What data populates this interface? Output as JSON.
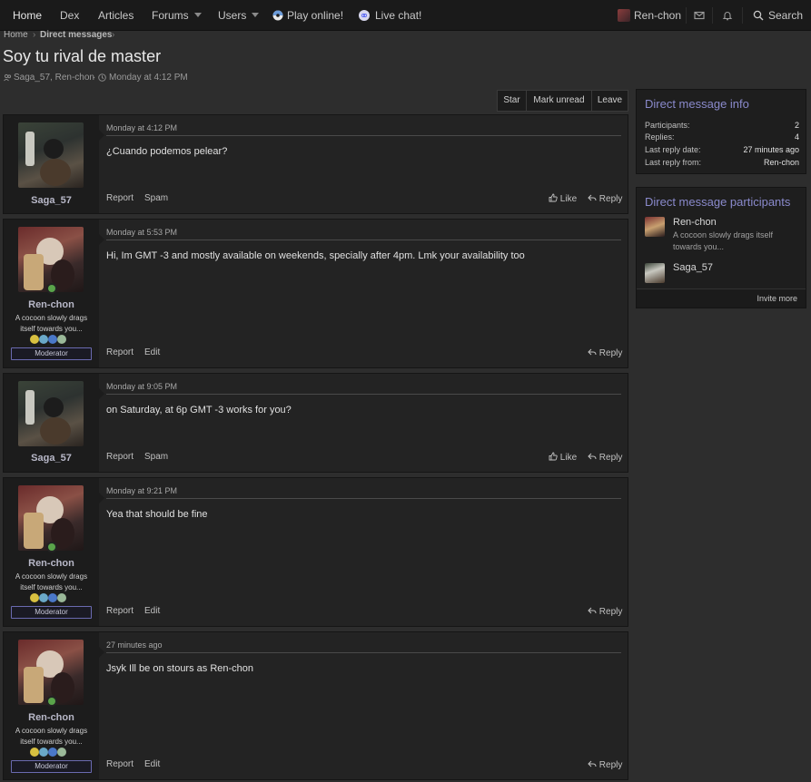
{
  "nav": {
    "items": [
      {
        "label": "Home"
      },
      {
        "label": "Dex"
      },
      {
        "label": "Articles"
      },
      {
        "label": "Forums"
      },
      {
        "label": "Users"
      },
      {
        "label": "Play online!"
      },
      {
        "label": "Live chat!"
      }
    ],
    "user": "Ren-chon",
    "search": "Search"
  },
  "breadcrumb": [
    "Home",
    "Direct messages"
  ],
  "page": {
    "title": "Soy tu rival de master",
    "participants_line": "Saga_57, Ren-chon",
    "sep": "·",
    "date": "Monday at 4:12 PM"
  },
  "actions": [
    "Star",
    "Mark unread",
    "Leave"
  ],
  "messages": [
    {
      "time": "Monday at 4:12 PM",
      "user": "Saga_57",
      "body": "¿Cuando podemos pelear?",
      "left": [
        "Report",
        "Spam"
      ],
      "like": "Like",
      "reply": "Reply"
    },
    {
      "time": "Monday at 5:53 PM",
      "user": "Ren-chon",
      "title": "A cocoon slowly drags itself towards you...",
      "banner": "Moderator",
      "body": "Hi, Im GMT -3 and mostly available on weekends, specially after 4pm. Lmk your availability too",
      "left": [
        "Report",
        "Edit"
      ],
      "reply": "Reply"
    },
    {
      "time": "Monday at 9:05 PM",
      "user": "Saga_57",
      "body": "on Saturday, at 6p GMT -3 works for you?",
      "left": [
        "Report",
        "Spam"
      ],
      "like": "Like",
      "reply": "Reply"
    },
    {
      "time": "Monday at 9:21 PM",
      "user": "Ren-chon",
      "title": "A cocoon slowly drags itself towards you...",
      "banner": "Moderator",
      "body": "Yea that should be fine",
      "left": [
        "Report",
        "Edit"
      ],
      "reply": "Reply"
    },
    {
      "time": "27 minutes ago",
      "user": "Ren-chon",
      "title": "A cocoon slowly drags itself towards you...",
      "banner": "Moderator",
      "body": "Jsyk Ill be on stours as Ren-chon",
      "left": [
        "Report",
        "Edit"
      ],
      "reply": "Reply"
    }
  ],
  "info": {
    "title": "Direct message info",
    "rows": [
      {
        "k": "Participants:",
        "v": "2"
      },
      {
        "k": "Replies:",
        "v": "4"
      },
      {
        "k": "Last reply date:",
        "v": "27 minutes ago"
      },
      {
        "k": "Last reply from:",
        "v": "Ren-chon"
      }
    ]
  },
  "participants": {
    "title": "Direct message participants",
    "list": [
      {
        "name": "Ren-chon",
        "title": "A cocoon slowly drags itself towards you..."
      },
      {
        "name": "Saga_57"
      }
    ],
    "invite": "Invite more"
  },
  "colors": {
    "accent": "#8a8acc",
    "online": "#5aa44a",
    "mod_border": "#6a6ab0"
  }
}
